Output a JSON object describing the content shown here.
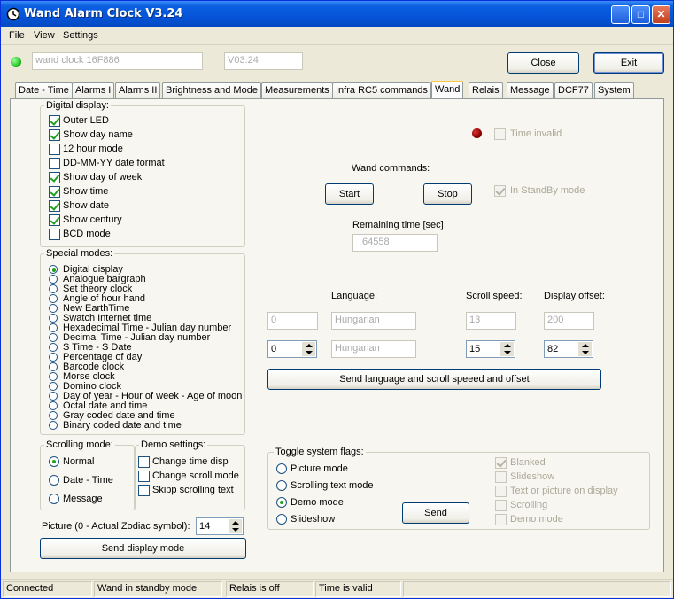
{
  "window": {
    "title": "Wand Alarm Clock V3.24",
    "min": "_",
    "max": "□",
    "close": "✕"
  },
  "menu": [
    "File",
    "View",
    "Settings"
  ],
  "top": {
    "device": "wand clock 16F886",
    "version": "V03.24",
    "close_btn": "Close",
    "exit_btn": "Exit"
  },
  "tabs": [
    "Date - Time",
    "Alarms I",
    "Alarms II",
    "Brightness and Mode",
    "Measurements",
    "Infra RC5 commands",
    "Wand",
    "Relais",
    "Message",
    "DCF77",
    "System"
  ],
  "digital": {
    "label": "Digital display:",
    "items": [
      {
        "text": "Outer LED",
        "checked": true
      },
      {
        "text": "Show day name",
        "checked": true
      },
      {
        "text": "12 hour mode",
        "checked": false
      },
      {
        "text": "DD-MM-YY date format",
        "checked": false
      },
      {
        "text": "Show day of week",
        "checked": true
      },
      {
        "text": "Show time",
        "checked": true
      },
      {
        "text": "Show date",
        "checked": true
      },
      {
        "text": "Show century",
        "checked": true
      },
      {
        "text": "BCD mode",
        "checked": false
      }
    ]
  },
  "special": {
    "label": "Special modes:",
    "selected": 0,
    "items": [
      "Digital display",
      "Analogue bargraph",
      "Set theory clock",
      "Angle of hour hand",
      "New EarthTime",
      "Swatch Internet time",
      "Hexadecimal Time - Julian day number",
      "Decimal Time - Julian day number",
      "S Time - S Date",
      "Percentage of day",
      "Barcode clock",
      "Morse clock",
      "Domino clock",
      "Day of year - Hour of week - Age of moon",
      "Octal date and time",
      "Gray coded date and time",
      "Binary coded date and time"
    ]
  },
  "scrolling": {
    "label": "Scrolling mode:",
    "selected": 0,
    "items": [
      "Normal",
      "Date - Time",
      "Message"
    ]
  },
  "demo": {
    "label": "Demo settings:",
    "items": [
      "Change time disp",
      "Change scroll mode",
      "Skipp scrolling text"
    ]
  },
  "picture": {
    "label": "Picture (0 - Actual Zodiac symbol):",
    "value": "14"
  },
  "send_display": "Send display mode",
  "wand": {
    "time_invalid": "Time invalid",
    "commands_label": "Wand commands:",
    "start": "Start",
    "stop": "Stop",
    "standby": "In StandBy mode",
    "remaining_label": "Remaining time [sec]",
    "remaining": "64558"
  },
  "lang": {
    "language_label": "Language:",
    "scroll_label": "Scroll speed:",
    "offset_label": "Display offset:",
    "cur_lang_num": "0",
    "cur_lang": "Hungarian",
    "cur_scroll": "13",
    "cur_offset": "200",
    "set_lang_num": "0",
    "set_lang": "Hungarian",
    "set_scroll": "15",
    "set_offset": "82",
    "send": "Send language and scroll speeed and offset"
  },
  "flags": {
    "label": "Toggle system flags:",
    "selected": 2,
    "radios": [
      "Picture mode",
      "Scrolling text mode",
      "Demo mode",
      "Slideshow"
    ],
    "send": "Send",
    "checks": [
      {
        "text": "Blanked",
        "checked": true
      },
      {
        "text": "Slideshow",
        "checked": false
      },
      {
        "text": "Text or picture on display",
        "checked": false
      },
      {
        "text": "Scrolling",
        "checked": false
      },
      {
        "text": "Demo mode",
        "checked": false
      }
    ]
  },
  "status": [
    "Connected",
    "Wand in standby mode",
    "Relais is off",
    "Time is valid",
    ""
  ],
  "colors": {
    "led_green": "#22c322",
    "led_red": "#8b0000",
    "title_blue": "#0654d9"
  }
}
